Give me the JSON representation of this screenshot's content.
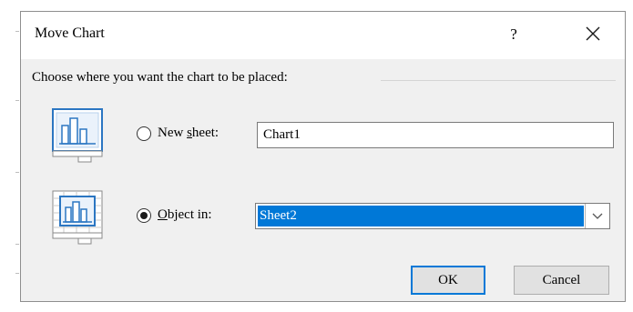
{
  "dialog": {
    "title": "Move Chart",
    "help_glyph": "?",
    "group_label": "Choose where you want the chart to be placed:"
  },
  "options": {
    "new_sheet": {
      "label_prefix": "New ",
      "label_accel": "s",
      "label_suffix": "heet:",
      "value": "Chart1",
      "selected": false
    },
    "object_in": {
      "label_prefix": "",
      "label_accel": "O",
      "label_suffix": "bject in:",
      "value": "Sheet2",
      "selected": true
    }
  },
  "buttons": {
    "ok_label": "OK",
    "cancel_label": "Cancel"
  },
  "colors": {
    "selection": "#0078d7",
    "icon_blue": "#2b76c2",
    "dialog_bg": "#f0f0f0"
  },
  "icons": {
    "new_sheet": "chart-sheet-icon",
    "object_in": "embedded-chart-icon",
    "dropdown": "chevron-down-icon",
    "close": "close-icon"
  }
}
